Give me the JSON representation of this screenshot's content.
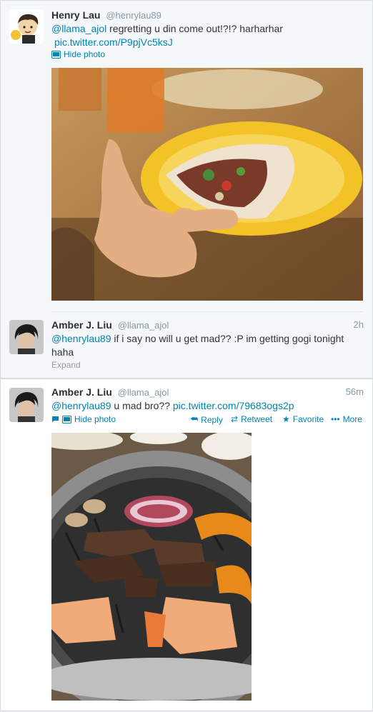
{
  "tweets": [
    {
      "name": "Henry Lau",
      "handle": "@henrylau89",
      "mention": "@llama_ajol",
      "text": " regretting u din come out!?!? harharhar",
      "link": "pic.twitter.com/P9pjVc5ksJ",
      "hide_photo": "Hide photo",
      "avatar_text": "Body"
    },
    {
      "name": "Amber J. Liu",
      "handle": "@llama_ajol",
      "time": "2h",
      "mention": "@henrylau89",
      "text": " if i say no will u get mad?? :P im getting gogi tonight haha",
      "expand": "Expand"
    },
    {
      "name": "Amber J. Liu",
      "handle": "@llama_ajol",
      "time": "56m",
      "mention": "@henrylau89",
      "text": " u mad bro?? ",
      "link": "pic.twitter.com/79683ogs2p",
      "hide_photo": "Hide photo",
      "actions": {
        "reply": "Reply",
        "retweet": "Retweet",
        "favorite": "Favorite",
        "more": "More"
      }
    }
  ],
  "colors": {
    "link": "#0084b4",
    "muted": "#8899a6",
    "background": "#e9edf0"
  }
}
